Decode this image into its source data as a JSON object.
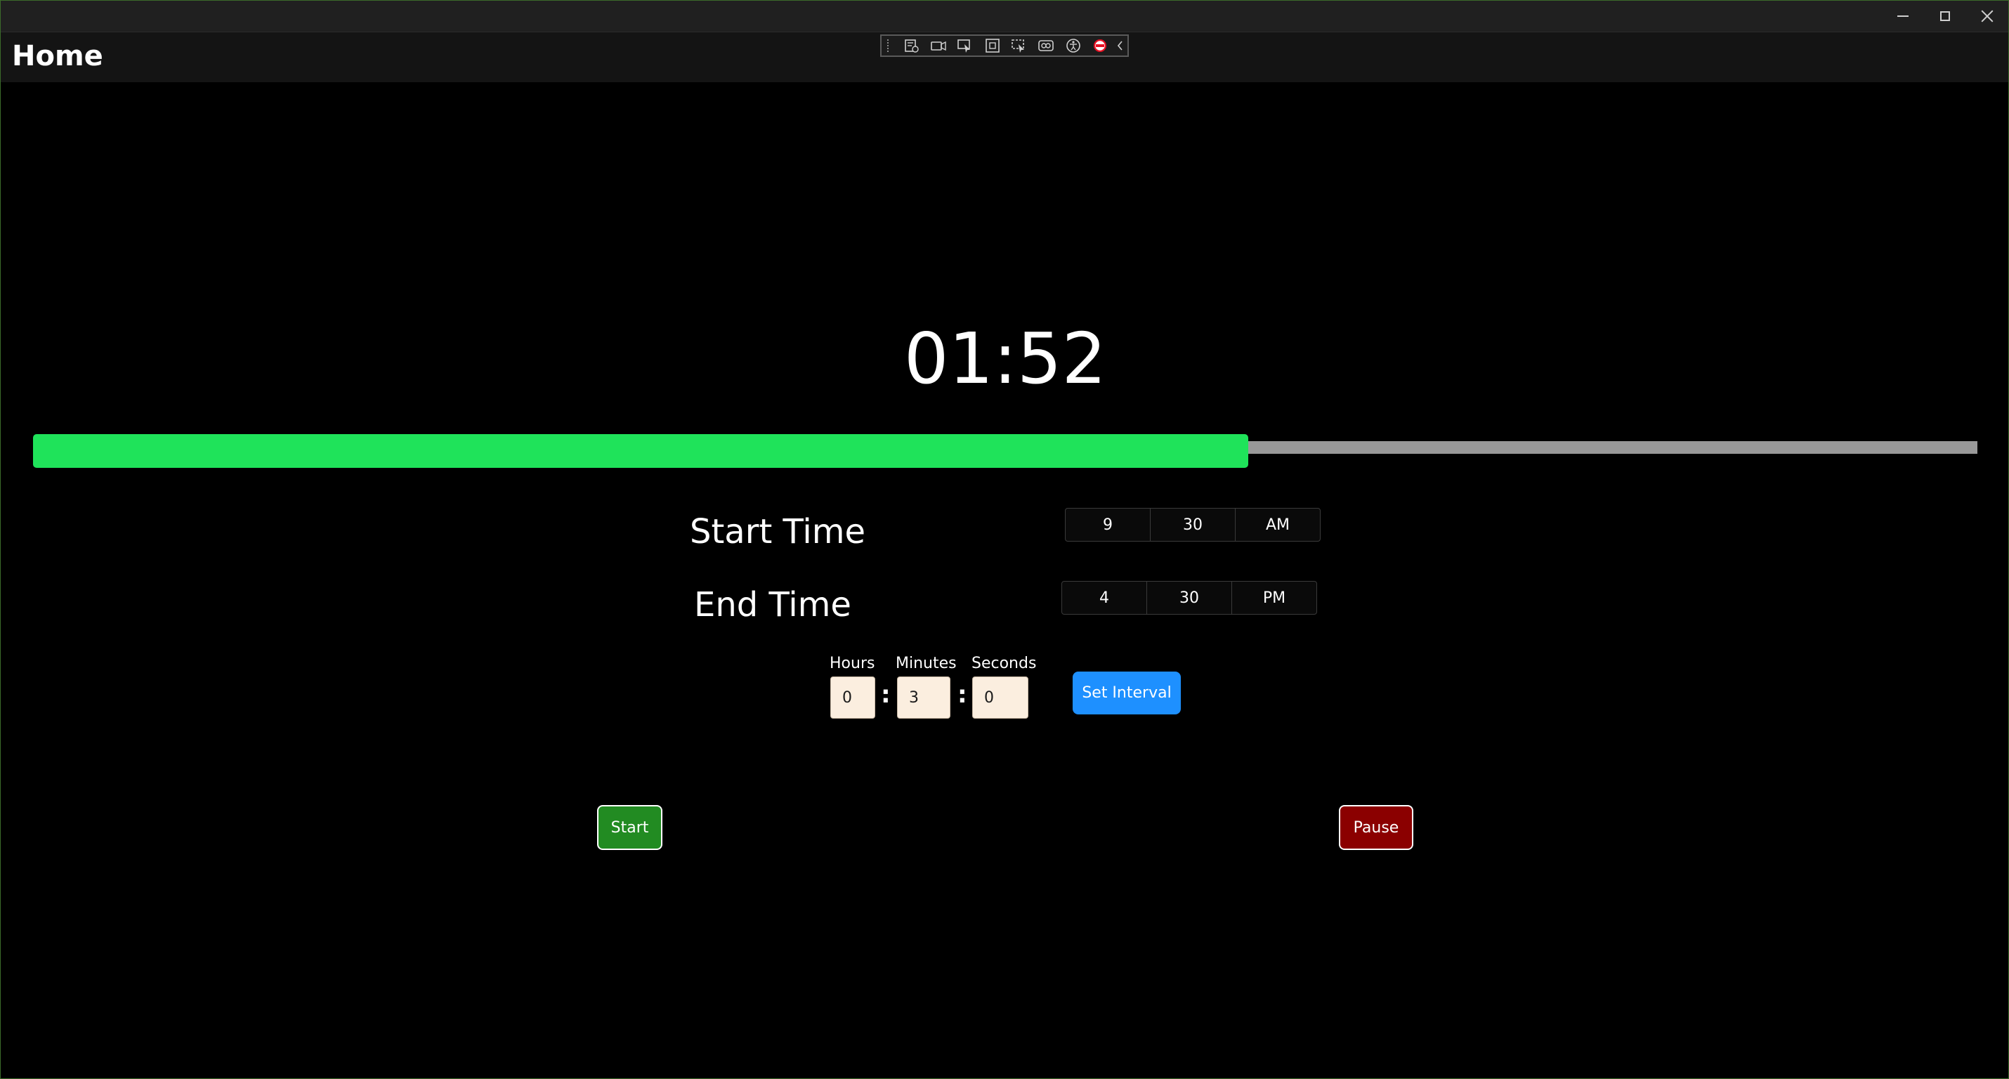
{
  "window": {
    "controls": {
      "minimize_icon": "minimize-icon",
      "maximize_icon": "maximize-icon",
      "close_icon": "close-icon"
    }
  },
  "header": {
    "title": "Home"
  },
  "devtoolbar": {
    "icons": [
      "live-visual-tree-icon",
      "record-icon",
      "select-element-icon",
      "display-layout-adorners-icon",
      "track-focused-element-icon",
      "binding-failures-icon",
      "accessibility-checker-icon",
      "hot-reload-stop-icon",
      "collapse-chevron-icon"
    ]
  },
  "timer": {
    "display": "01:52"
  },
  "progress": {
    "value_percent": 62.5,
    "fill_color": "#1fe35a",
    "track_color": "#999999"
  },
  "start_time": {
    "label": "Start Time",
    "hour": "9",
    "minute": "30",
    "period": "AM"
  },
  "end_time": {
    "label": "End Time",
    "hour": "4",
    "minute": "30",
    "period": "PM"
  },
  "interval": {
    "hours_label": "Hours",
    "minutes_label": "Minutes",
    "seconds_label": "Seconds",
    "hours_value": "0",
    "minutes_value": "3",
    "seconds_value": "0",
    "separator": ":",
    "set_button": "Set Interval"
  },
  "actions": {
    "start_label": "Start",
    "pause_label": "Pause"
  },
  "colors": {
    "start_button": "#228b22",
    "pause_button": "#8b0000",
    "set_interval_button": "#1e90ff",
    "input_background": "#fbeedf"
  }
}
